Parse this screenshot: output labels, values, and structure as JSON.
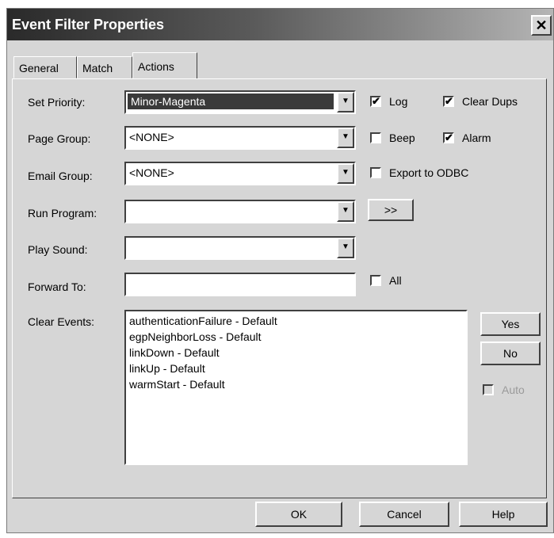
{
  "window": {
    "title": "Event Filter Properties",
    "close_glyph": "✕"
  },
  "tabs": [
    {
      "label": "General"
    },
    {
      "label": "Match"
    },
    {
      "label": "Actions",
      "active": true
    }
  ],
  "actions": {
    "set_priority": {
      "label": "Set Priority:",
      "value": "Minor-Magenta"
    },
    "page_group": {
      "label": "Page Group:",
      "value": "<NONE>"
    },
    "email_group": {
      "label": "Email Group:",
      "value": "<NONE>"
    },
    "run_program": {
      "label": "Run Program:",
      "value": "",
      "browse_label": ">>"
    },
    "play_sound": {
      "label": "Play Sound:",
      "value": ""
    },
    "forward_to": {
      "label": "Forward To:",
      "value": ""
    },
    "clear_events": {
      "label": "Clear Events:",
      "items": [
        "authenticationFailure -  Default",
        "egpNeighborLoss -  Default",
        "linkDown -  Default",
        "linkUp -  Default",
        "warmStart -  Default"
      ],
      "yes_label": "Yes",
      "no_label": "No"
    },
    "checkboxes": {
      "log": {
        "label": "Log",
        "checked": true
      },
      "clear_dups": {
        "label": "Clear Dups",
        "checked": true
      },
      "beep": {
        "label": "Beep",
        "checked": false
      },
      "alarm": {
        "label": "Alarm",
        "checked": true
      },
      "export_odbc": {
        "label": "Export to ODBC",
        "checked": false
      },
      "all": {
        "label": "All",
        "checked": false
      },
      "auto": {
        "label": "Auto",
        "checked": false,
        "disabled": true
      }
    }
  },
  "footer": {
    "ok_label": "OK",
    "cancel_label": "Cancel",
    "help_label": "Help"
  },
  "glyphs": {
    "check": "✔",
    "dropdown": "▼"
  }
}
